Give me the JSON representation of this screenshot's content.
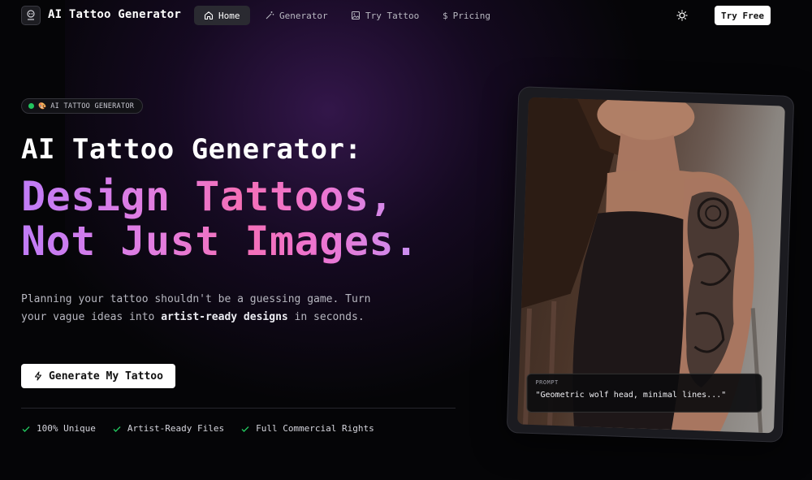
{
  "nav": {
    "brand": "AI Tattoo Generator",
    "items": [
      {
        "label": "Home",
        "icon": "home-icon",
        "active": true
      },
      {
        "label": "Generator",
        "icon": "magic-wand-icon",
        "active": false
      },
      {
        "label": "Try Tattoo",
        "icon": "image-icon",
        "active": false
      },
      {
        "label": "Pricing",
        "icon": "dollar-icon",
        "active": false
      }
    ],
    "try_free": "Try Free"
  },
  "hero": {
    "badge": "AI TATTOO GENERATOR",
    "title_line1": "AI Tattoo Generator:",
    "title_line2": "Design Tattoos,",
    "title_line3": "Not Just Images.",
    "desc_part1": "Planning your tattoo shouldn't be a guessing game. Turn your vague ideas into ",
    "desc_bold": "artist-ready designs",
    "desc_part2": " in seconds.",
    "cta": "Generate My Tattoo",
    "features": [
      "100% Unique",
      "Artist-Ready Files",
      "Full Commercial Rights"
    ]
  },
  "card": {
    "prompt_label": "PROMPT",
    "prompt_text": "\"Geometric wolf head, minimal lines...\""
  },
  "colors": {
    "accent_green": "#22c55e",
    "gradient_purple": "#c07cf6",
    "gradient_pink": "#f46fb6"
  }
}
